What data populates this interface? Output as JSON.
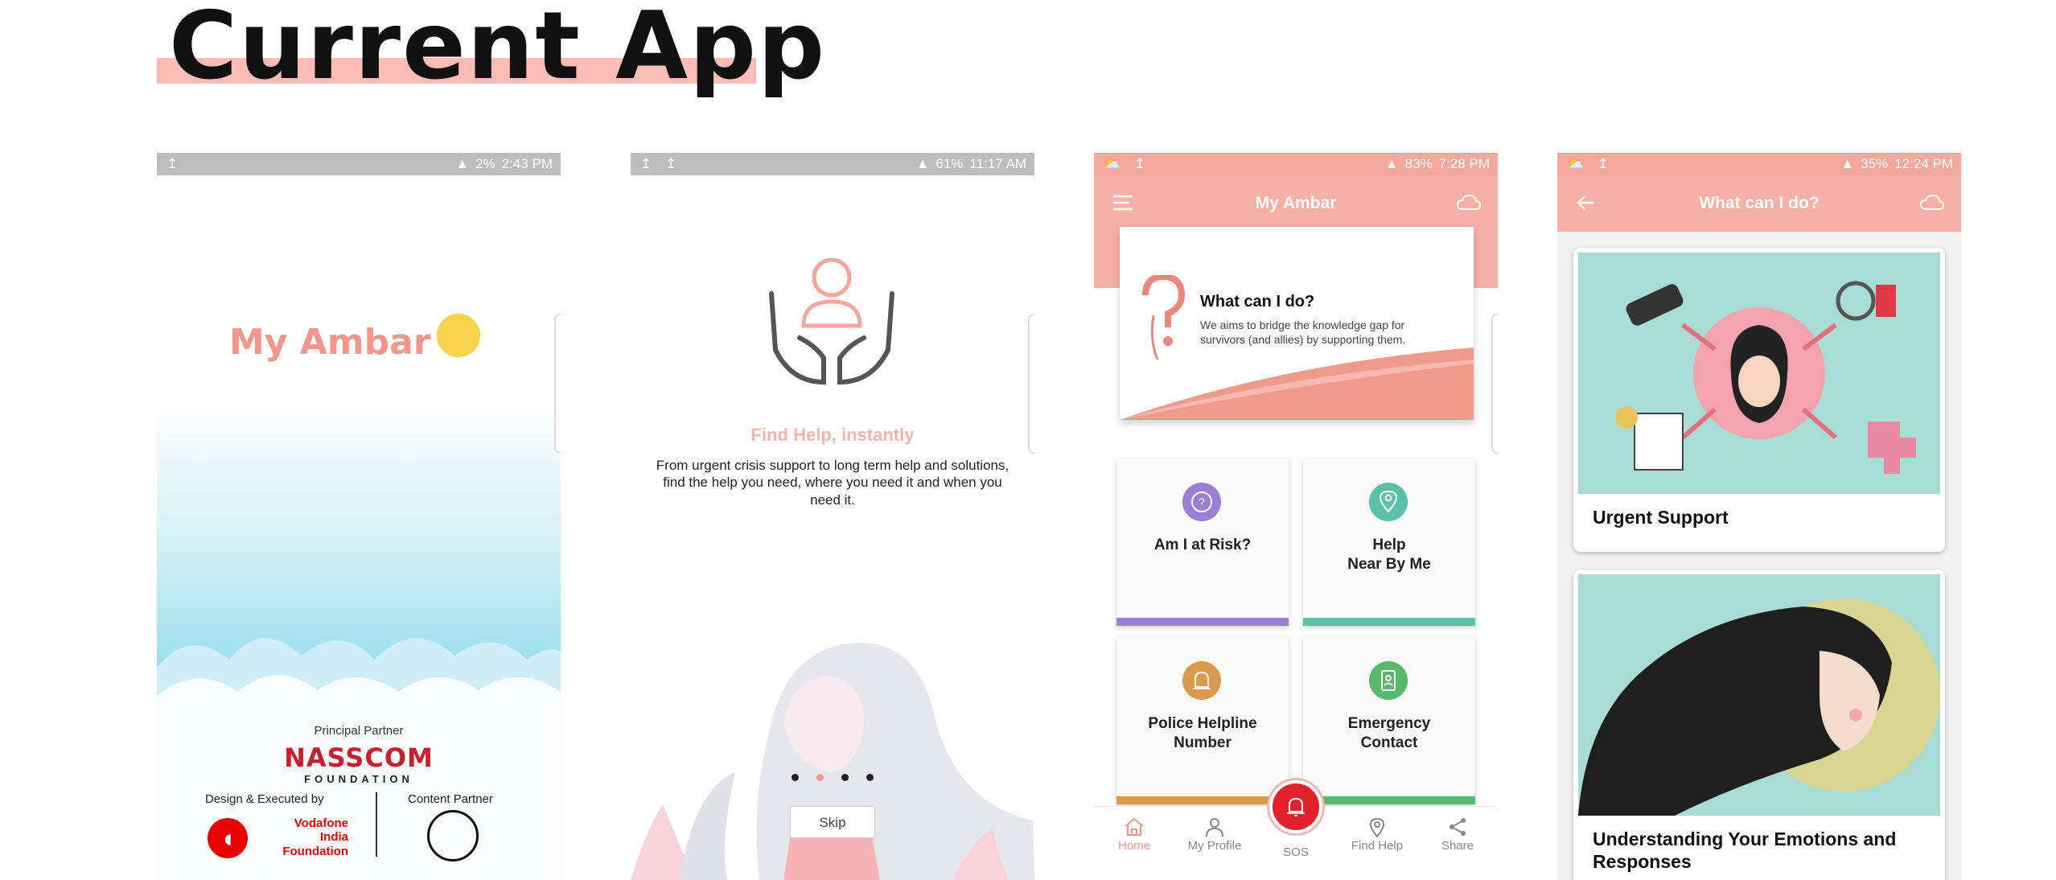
{
  "heading": "Current App",
  "screens": [
    {
      "status_time": "2:43 PM",
      "status_battery": "2%",
      "logo_text": "My Ambar",
      "principal_label": "Principal Partner",
      "principal_name": "NASSCOM",
      "principal_sub": "FOUNDATION",
      "design_label": "Design & Executed by",
      "design_partner": "Vodafone India Foundation",
      "content_label": "Content Partner"
    },
    {
      "status_time": "11:17 AM",
      "status_battery": "61%",
      "title": "Find Help, instantly",
      "body": "From urgent crisis support to long term help and solutions, find the help you need, where you need it and when you need it.",
      "skip_label": "Skip",
      "active_dot": 2
    },
    {
      "status_time": "7:28 PM",
      "status_battery": "83%",
      "app_title": "My Ambar",
      "hero_title": "What can I do?",
      "hero_sub": "We aims to bridge the knowledge gap for survivors (and allies) by supporting them.",
      "tiles": [
        {
          "label": "Am I at Risk?",
          "color": "#9b7fd6"
        },
        {
          "label": "Help\nNear By Me",
          "color": "#5cc0a6"
        },
        {
          "label": "Police Helpline\nNumber",
          "color": "#d99a4e"
        },
        {
          "label": "Emergency\nContact",
          "color": "#56b96b"
        }
      ],
      "nav": [
        "Home",
        "My Profile",
        "SOS",
        "Find Help",
        "Share"
      ]
    },
    {
      "status_time": "12:24 PM",
      "status_battery": "35%",
      "app_title": "What can I do?",
      "cards": [
        "Urgent Support",
        "Understanding Your Emotions and Responses"
      ]
    }
  ],
  "colors": {
    "accent": "#f6b0a5",
    "accent_text": "#f4968a",
    "sos": "#e3212b"
  }
}
